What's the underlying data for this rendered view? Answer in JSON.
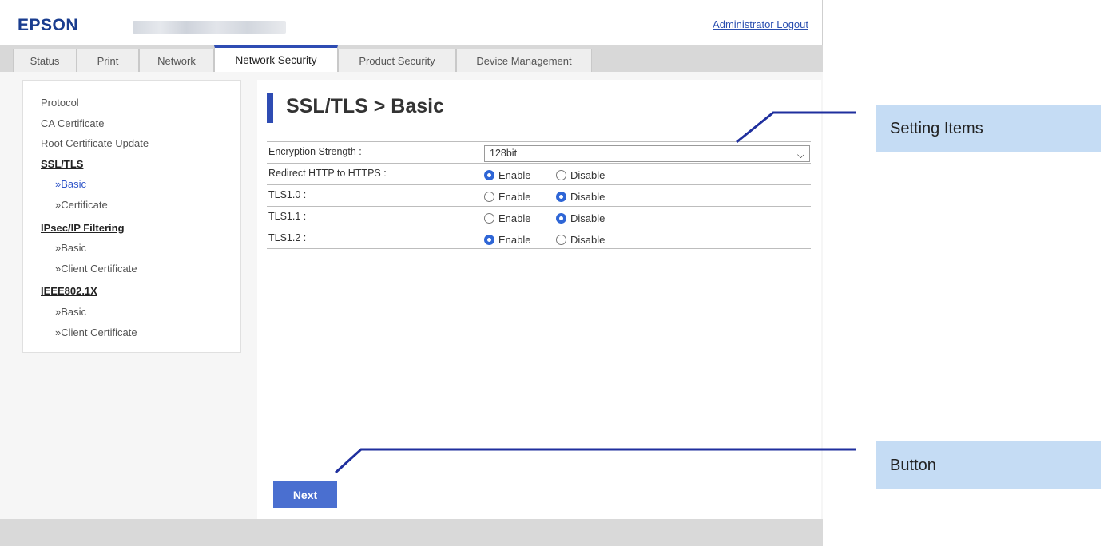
{
  "header": {
    "logo": "EPSON",
    "logout_label": "Administrator Logout"
  },
  "tabs": [
    {
      "label": "Status"
    },
    {
      "label": "Print"
    },
    {
      "label": "Network"
    },
    {
      "label": "Network Security",
      "active": true
    },
    {
      "label": "Product Security"
    },
    {
      "label": "Device Management"
    }
  ],
  "sidebar": {
    "items": [
      {
        "label": "Protocol"
      },
      {
        "label": "CA Certificate"
      },
      {
        "label": "Root Certificate Update"
      },
      {
        "label": "SSL/TLS",
        "heading": true
      },
      {
        "label": "»Basic",
        "current": true
      },
      {
        "label": "»Certificate"
      },
      {
        "label": "IPsec/IP Filtering",
        "heading": true
      },
      {
        "label": "»Basic"
      },
      {
        "label": "»Client Certificate"
      },
      {
        "label": "IEEE802.1X",
        "heading": true
      },
      {
        "label": "»Basic"
      },
      {
        "label": "»Client Certificate"
      }
    ]
  },
  "main": {
    "title": "SSL/TLS > Basic",
    "settings": {
      "encryption_strength": {
        "label": "Encryption Strength :",
        "value": "128bit"
      },
      "redirect_https": {
        "label": "Redirect HTTP to HTTPS :",
        "enable": "Enable",
        "disable": "Disable",
        "selected": "enable"
      },
      "tls10": {
        "label": "TLS1.0 :",
        "enable": "Enable",
        "disable": "Disable",
        "selected": "disable"
      },
      "tls11": {
        "label": "TLS1.1 :",
        "enable": "Enable",
        "disable": "Disable",
        "selected": "disable"
      },
      "tls12": {
        "label": "TLS1.2 :",
        "enable": "Enable",
        "disable": "Disable",
        "selected": "enable"
      }
    },
    "next_label": "Next"
  },
  "callouts": {
    "setting_items": "Setting Items",
    "button": "Button"
  },
  "colors": {
    "accent": "#2e4cb3",
    "button": "#4a6fd0",
    "callout_bg": "#c5dcf4",
    "callout_line": "#1f2f9e"
  }
}
